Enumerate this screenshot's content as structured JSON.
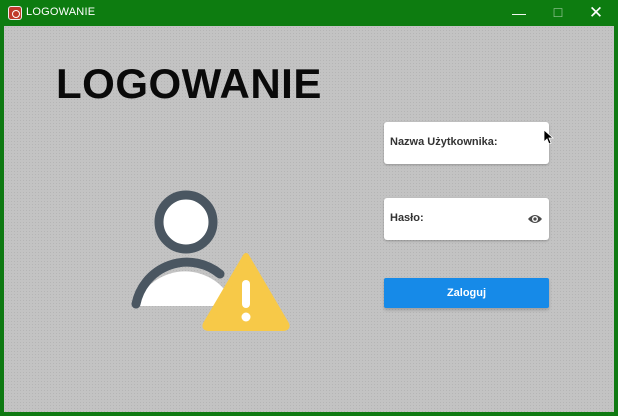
{
  "window": {
    "title": "LOGOWANIE",
    "minimize_glyph": "—",
    "maximize_glyph": "☐",
    "close_glyph": "✕"
  },
  "main": {
    "heading": "LOGOWANIE",
    "illustration_icons": [
      "user-icon",
      "warning-icon"
    ],
    "username_field": {
      "label": "Nazwa Użytkownika:",
      "value": ""
    },
    "password_field": {
      "label": "Hasło:",
      "value": "",
      "toggle_icon": "eye-icon"
    },
    "login_button": "Zaloguj"
  },
  "colors": {
    "titlebar": "#0d7c10",
    "background": "#c3c3c3",
    "button": "#168ae8",
    "warning": "#f7c948",
    "user_icon": "#4a5661"
  }
}
